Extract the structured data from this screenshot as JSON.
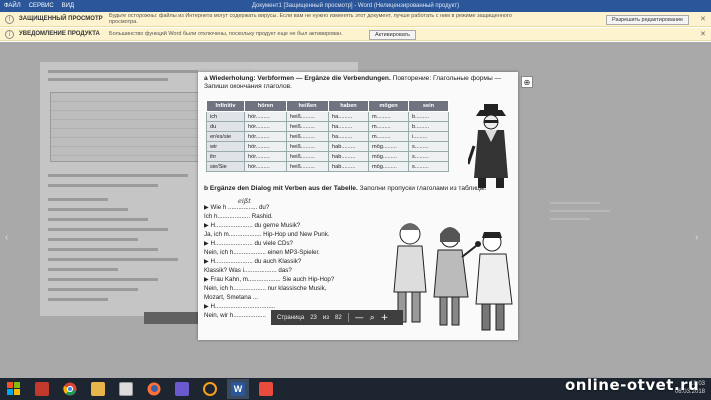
{
  "titlebar": {
    "menu": [
      "ФАЙЛ",
      "СЕРВИС",
      "ВИД"
    ],
    "title": "Документ1 [Защищенный просмотр] - Word (Нелицензированный продукт)"
  },
  "banners": [
    {
      "icon": "shield-icon",
      "head": "ЗАЩИЩЕННЫЙ ПРОСМОТР",
      "message": "Будьте осторожны: файлы из Интернета могут содержать вирусы. Если вам не нужно изменять этот документ, лучше работать с ним в режиме защищенного просмотра.",
      "button": "Разрешить редактирование"
    },
    {
      "icon": "info-icon",
      "head": "УВЕДОМЛЕНИЕ ПРОДУКТА",
      "message": "Большинство функций Word были отключены, поскольку продукт еще не был активирован.",
      "button": "Активировать"
    }
  ],
  "page": {
    "heading_a": "a  Wiederholung: Verbformen — Ergänze die Verbendungen.",
    "heading_a_ru": "Повторение: Глагольные формы — Запиши окончания глаголов.",
    "table": {
      "headers": [
        "Infinitiv",
        "hören",
        "heißen",
        "haben",
        "mögen",
        "sein"
      ],
      "rows": [
        [
          "ich",
          "hör.........",
          "heiß.........",
          "ha.........",
          "m.........",
          "b........."
        ],
        [
          "du",
          "hör.........",
          "heiß.........",
          "ha.........",
          "m.........",
          "b........."
        ],
        [
          "er/es/sie",
          "hör.........",
          "heiß.........",
          "ha.........",
          "m.........",
          "i........."
        ],
        [
          "wir",
          "hör.........",
          "heiß.........",
          "hab.........",
          "mög.........",
          "s........."
        ],
        [
          "ihr",
          "hör.........",
          "heiß.........",
          "hab.........",
          "mög.........",
          "s........."
        ],
        [
          "sie/Sie",
          "hör.........",
          "heiß.........",
          "hab.........",
          "mög.........",
          "s........."
        ]
      ]
    },
    "heading_b": "b  Ergänze den Dialog mit Verben aus der Tabelle.",
    "heading_b_ru": "Заполни пропуски глаголами из таблицы.",
    "handwritten": "eißt",
    "dialog": [
      "▶ Wie h ................. du?",
      "  Ich h................... Rashid.",
      "▶ H...................... du gerne Musik?",
      "  Ja, ich m................... Hip-Hop und New Punk.",
      "▶ H...................... du viele CDs?",
      "  Nein, ich h................... einen MP3-Spieler.",
      "▶ H...................... du auch Klassik?",
      "  Klassik? Was i................... das?",
      "▶ Frau Kahn, m................... Sie auch Hip-Hop?",
      "  Nein, ich h................... nur klassische Musik,",
      "  Mozart, Smetana ...",
      "▶ H...................................",
      "  Nein, wir h..................."
    ]
  },
  "page_nav": {
    "label": "Страница",
    "current": "23",
    "of": "из",
    "total": "82",
    "zoom_out": "—",
    "zoom_in": "+"
  },
  "taskbar": {
    "apps": [
      "start-icon",
      "explorer-icon",
      "chrome-icon",
      "notepad-icon",
      "media-icon",
      "firefox-icon",
      "tweaks-icon",
      "overwatch-icon",
      "word-icon",
      "paint-icon"
    ],
    "tray_time": "18:03",
    "tray_date": "06.03.2018"
  },
  "watermark": "online-otvet.ru"
}
